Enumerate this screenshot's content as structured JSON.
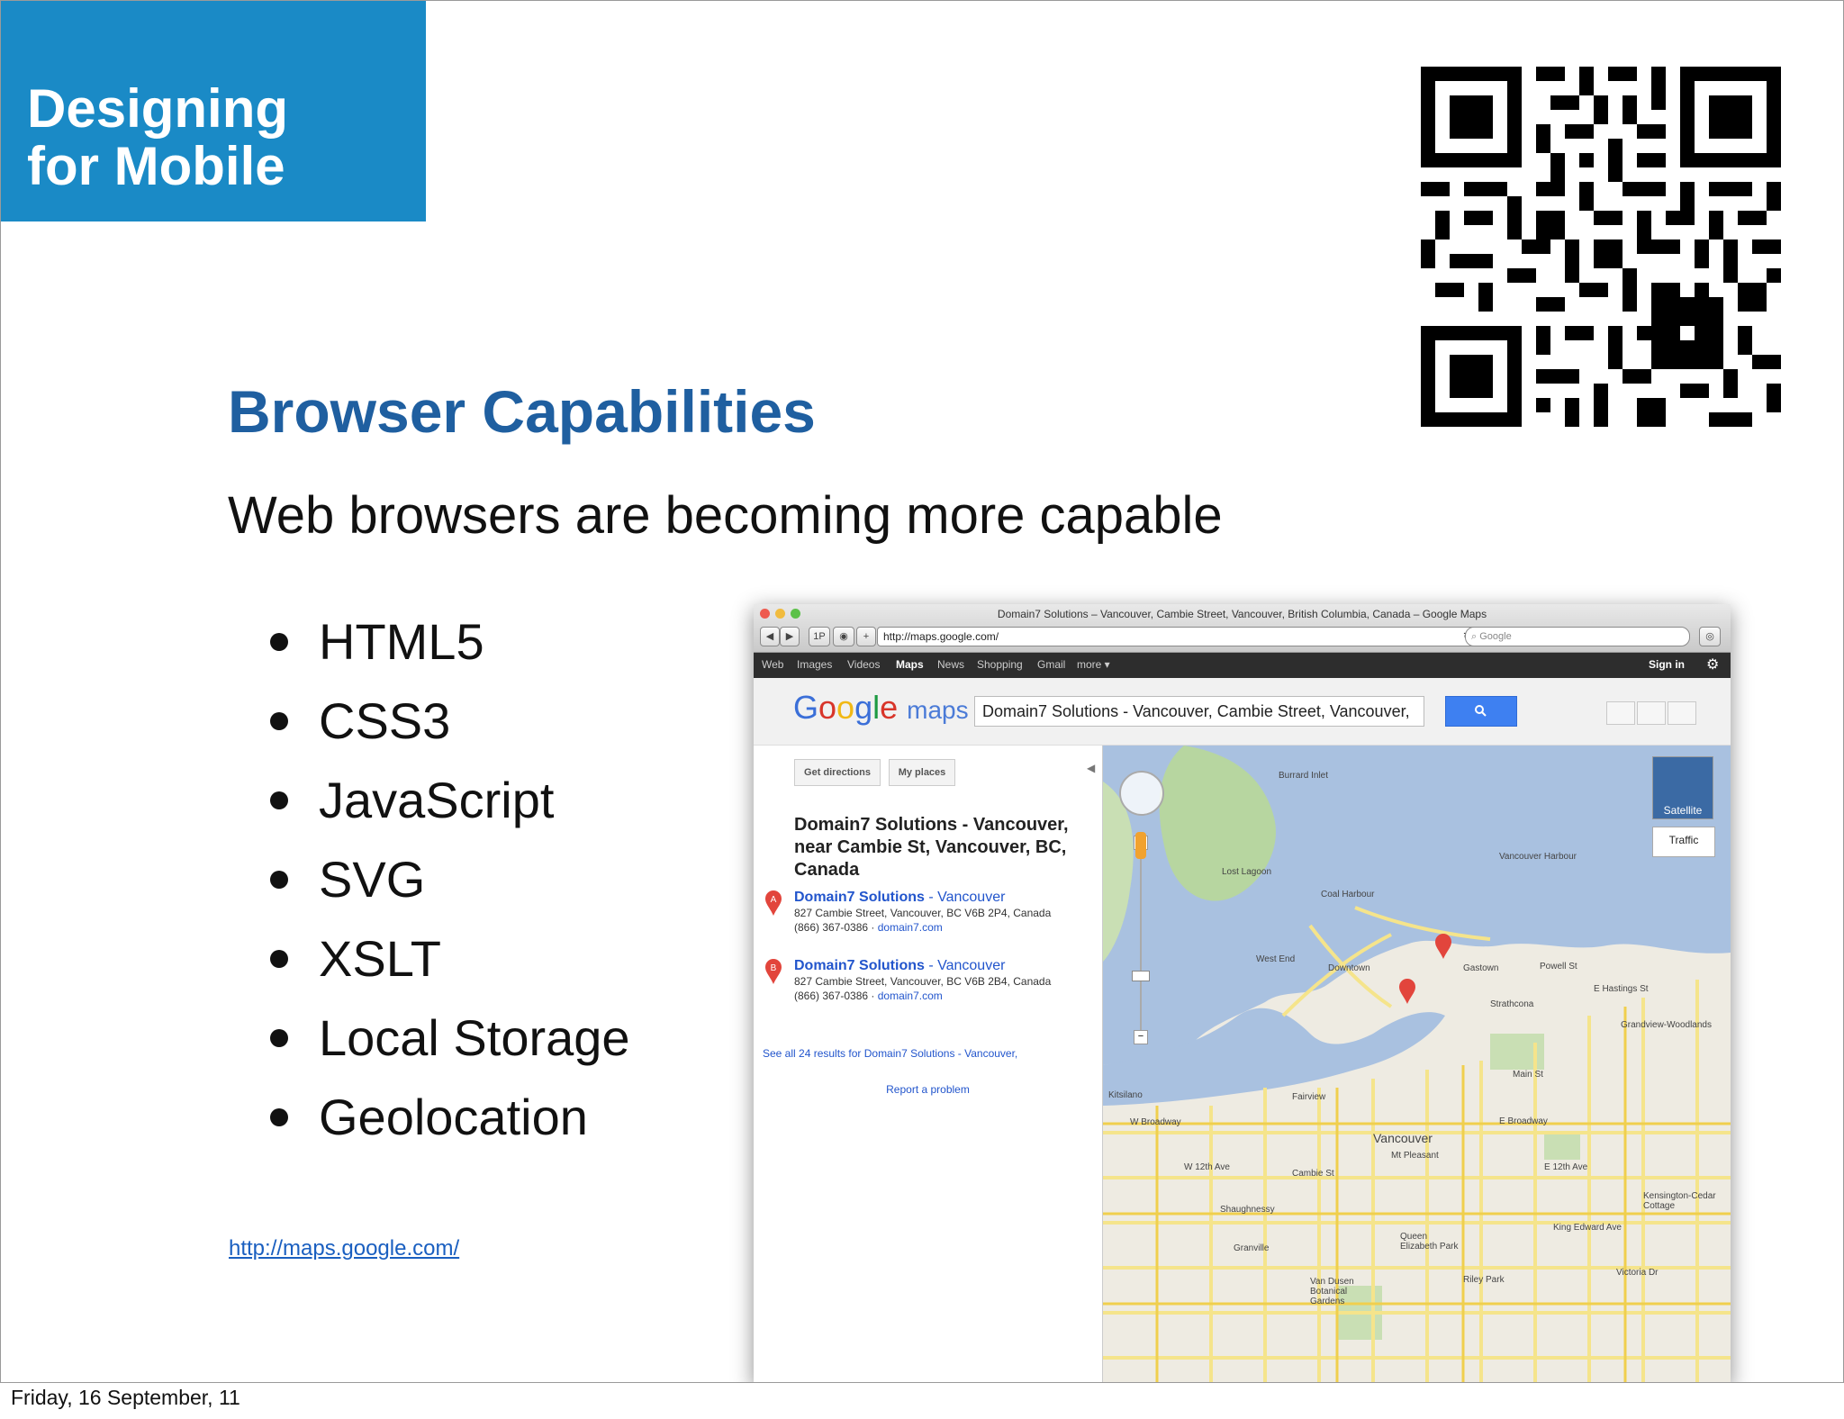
{
  "corner": {
    "line1": "Designing",
    "line2": "for Mobile",
    "color": "#1a8ac6"
  },
  "qr_code": {
    "icon": "qr-code"
  },
  "slide": {
    "title": "Browser Capabilities",
    "subtitle": "Web browsers are becoming more capable",
    "bullets": [
      "HTML5",
      "CSS3",
      "JavaScript",
      "SVG",
      "XSLT",
      "Local Storage",
      "Geolocation"
    ],
    "link": "http://maps.google.com/",
    "title_color": "#1f5fa0"
  },
  "footer": {
    "date": "Friday, 16 September, 11"
  },
  "browser": {
    "window_title": "Domain7 Solutions – Vancouver, Cambie Street, Vancouver, British Columbia, Canada – Google Maps",
    "url": "http://maps.google.com/",
    "search_placeholder": "Google",
    "nav_button": "1P",
    "gbar": {
      "items": [
        "Web",
        "Images",
        "Videos",
        "Maps",
        "News",
        "Shopping",
        "Gmail",
        "more ▾"
      ],
      "sign_in": "Sign in"
    },
    "maps": {
      "logo_suffix": "maps",
      "query": "Domain7 Solutions - Vancouver, Cambie Street, Vancouver,",
      "get_directions": "Get directions",
      "my_places": "My places",
      "result_title": "Domain7 Solutions - Vancouver, near Cambie St, Vancouver, BC, Canada",
      "results": [
        {
          "marker": "A",
          "name": "Domain7 Solutions",
          "suffix": " - Vancouver",
          "address": "827 Cambie Street, Vancouver, BC V6B 2P4, Canada",
          "phone": "(866) 367-0386",
          "domain": "domain7.com"
        },
        {
          "marker": "B",
          "name": "Domain7 Solutions",
          "suffix": " - Vancouver",
          "address": "827 Cambie Street, Vancouver, BC V6B 2B4, Canada",
          "phone": "(866) 367-0386",
          "domain": "domain7.com"
        }
      ],
      "see_all": "See all 24 results for Domain7 Solutions - Vancouver,",
      "report": "Report a problem",
      "satellite": "Satellite",
      "traffic": "Traffic",
      "map_labels": [
        "Burrard Inlet",
        "Vancouver Harbour",
        "Lost Lagoon",
        "Coal Harbour",
        "West End",
        "Downtown",
        "Gastown",
        "Strathcona",
        "Grandview-Woodlands",
        "Kitsilano",
        "Fairview",
        "Vancouver",
        "Mt Pleasant",
        "Shaughnessy",
        "Riley Park",
        "Granville",
        "Van Dusen Botanical Gardens",
        "Queen Elizabeth Park",
        "Kensington-Cedar Cottage",
        "E Broadway",
        "W Broadway",
        "E 12th Ave",
        "W 12th Ave",
        "Powell St",
        "E Hastings St",
        "Victoria Dr",
        "Main St",
        "Cambie St",
        "King Edward Ave"
      ]
    }
  }
}
